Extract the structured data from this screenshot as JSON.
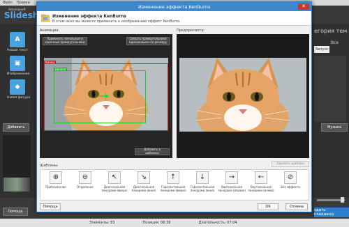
{
  "background": {
    "menu": [
      "Файл",
      "Правка"
    ],
    "logo_small": "Ashampoo®",
    "logo_big": "Slidesho",
    "tools": [
      {
        "label": "Новый текст",
        "icon": "text-tool-icon",
        "glyph": "A"
      },
      {
        "label": "Изображение",
        "icon": "image-tool-icon",
        "glyph": "▣"
      },
      {
        "label": "Новая фигура",
        "icon": "shape-tool-icon",
        "glyph": "◆"
      }
    ],
    "add_button": "Добавить",
    "category_text": "егория тем",
    "category_text2": "Все",
    "search_label": "Запуск",
    "music_button": "Музыка",
    "help_button": "Помощь",
    "create_button": "здать слайдшоу",
    "status": {
      "elements": "Элементы: 83",
      "position": "Позиция: 06:38",
      "duration": "Длительность: 07:04"
    }
  },
  "dialog": {
    "title": "Изменение эффекта KenBurns",
    "header_title": "Изменение эффекта KenBurns",
    "header_subtitle": "В этом окне вы можете применить к изображению эффект KenBurns.",
    "animation_label": "Анимация:",
    "preview_label": "Предпросмотр:",
    "btn_apply_start_end": "Применить начальные и конечные прямоугольники",
    "btn_scale_rects": "Связать прямоугольники одинаковыми по размеру",
    "tag_end": "Конец",
    "tag_start": "Начало",
    "btn_add_template": "Добавить в шаблоны",
    "btn_remove_template": "Удалить шаблон",
    "templates_label": "Шаблоны:",
    "templates": [
      {
        "label": "Приближение",
        "icon": "zoom-in-icon",
        "glyph": "⊕"
      },
      {
        "label": "Отдаление",
        "icon": "zoom-out-icon",
        "glyph": "⊖"
      },
      {
        "label": "Диагональная панорама (вверх)",
        "icon": "diagonal-pan-up-left-icon",
        "glyph": "↖"
      },
      {
        "label": "Диагональная панорама (вниз)",
        "icon": "diagonal-pan-down-right-icon",
        "glyph": "↘"
      },
      {
        "label": "Горизонтальная панорама (вверх)",
        "icon": "pan-up-icon",
        "glyph": "↑"
      },
      {
        "label": "Горизонтальная панорама (вниз)",
        "icon": "pan-down-icon",
        "glyph": "↓"
      },
      {
        "label": "Вертикальная панорама (вправо)",
        "icon": "pan-right-icon",
        "glyph": "→"
      },
      {
        "label": "Вертикальная панорама (влево)",
        "icon": "pan-left-icon",
        "glyph": "←"
      },
      {
        "label": "Без эффекта",
        "icon": "no-effect-icon",
        "glyph": "⊘"
      }
    ],
    "help_button": "Помощь",
    "ok_button": "OK",
    "cancel_button": "Отмена"
  }
}
